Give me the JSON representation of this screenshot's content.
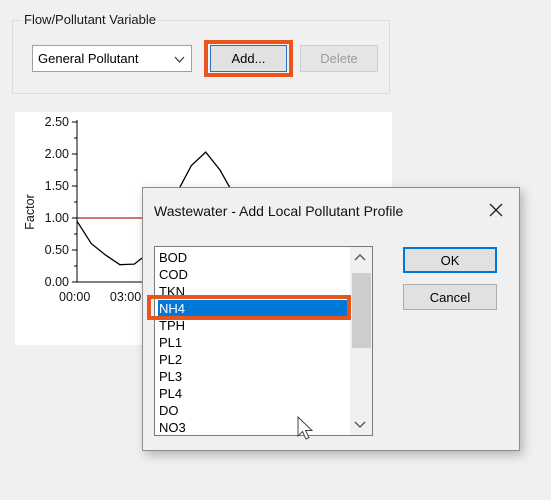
{
  "group": {
    "title": "Flow/Pollutant Variable",
    "combo_value": "General Pollutant",
    "add_label": "Add...",
    "delete_label": "Delete"
  },
  "chart_data": {
    "type": "line",
    "title": "",
    "xlabel": "",
    "ylabel": "Factor",
    "ylim": [
      0,
      2.5
    ],
    "yticks": [
      "2.50",
      "2.00",
      "1.50",
      "1.00",
      "0.50",
      "0.00"
    ],
    "xticks": [
      "00:00",
      "03:00"
    ],
    "series": [
      {
        "color": "#000000",
        "x_hours": [
          0,
          1,
          2,
          3,
          4,
          5,
          6,
          7,
          8,
          9,
          10,
          11,
          12
        ],
        "values": [
          0.95,
          0.6,
          0.42,
          0.27,
          0.28,
          0.45,
          0.85,
          1.4,
          1.82,
          2.03,
          1.75,
          1.35,
          1.15
        ]
      },
      {
        "color": "#b22222",
        "x_hours": [
          0,
          12
        ],
        "values": [
          1.0,
          1.0
        ]
      }
    ],
    "grid": false
  },
  "dialog": {
    "title": "Wastewater - Add Local Pollutant Profile",
    "items": [
      "BOD",
      "COD",
      "TKN",
      "NH4",
      "TPH",
      "PL1",
      "PL2",
      "PL3",
      "PL4",
      "DO",
      "NO3"
    ],
    "selected_index": 3,
    "ok_label": "OK",
    "cancel_label": "Cancel"
  },
  "icons": {
    "close": "close-icon",
    "combo_arrow": "chevron-down-icon",
    "scroll_up": "scroll-up-icon",
    "scroll_down": "scroll-down-icon",
    "cursor": "mouse-pointer-icon"
  }
}
